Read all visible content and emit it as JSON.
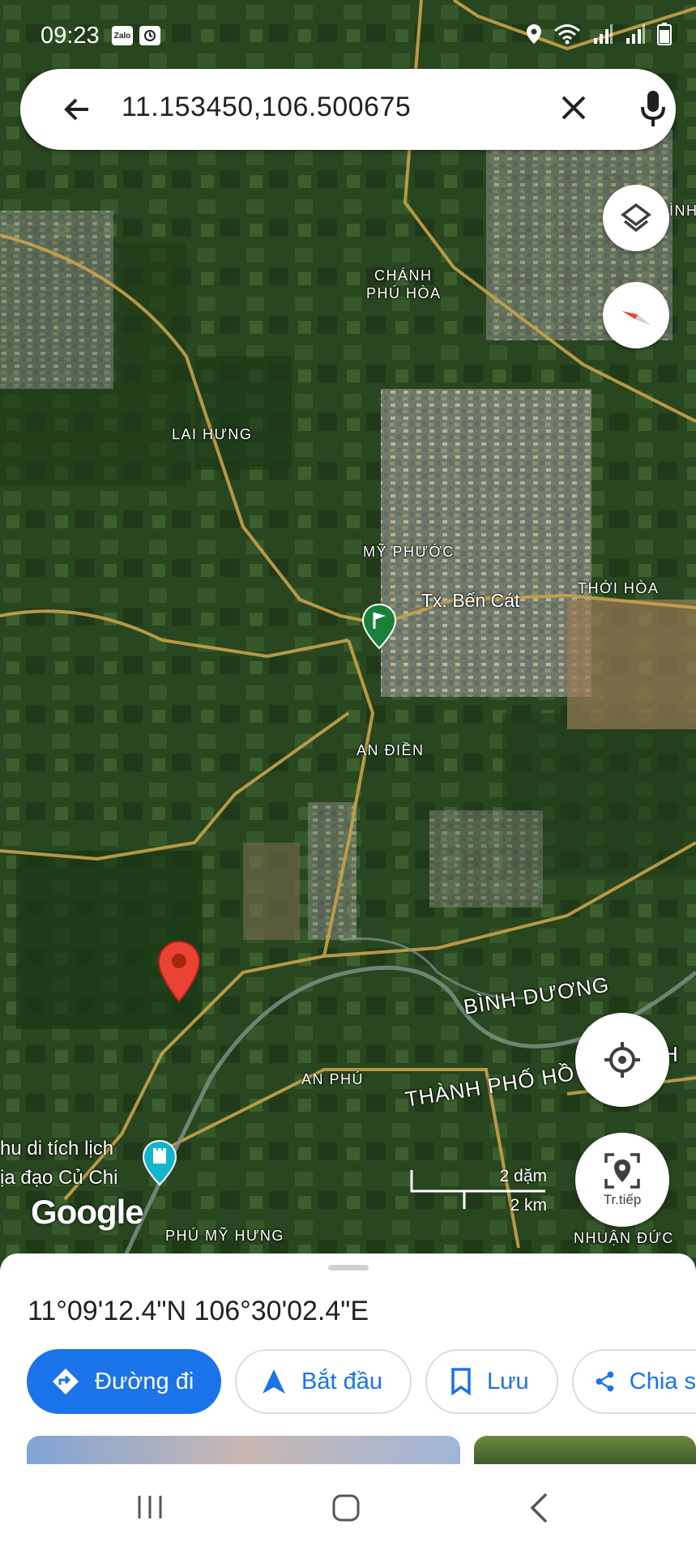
{
  "status_bar": {
    "time": "09:23",
    "left_icons": [
      "zalo-icon",
      "clock-app-icon"
    ],
    "right_icons": [
      "location-icon",
      "wifi-icon",
      "signal-icon",
      "signal-icon",
      "battery-icon"
    ],
    "zalo_label": "Zalo"
  },
  "search": {
    "query": "11.153450,106.500675",
    "back_icon": "arrow-left-icon",
    "clear_icon": "close-icon",
    "mic_icon": "mic-icon"
  },
  "map": {
    "labels": {
      "chanh_phu_hoa_1": "CHÁNH",
      "chanh_phu_hoa_2": "PHÚ HÒA",
      "lai_hung": "LAI HƯNG",
      "my_phuoc": "MỸ PHƯỚC",
      "ben_cat": "Tx. Bến Cát",
      "thoi_hoa": "THỚI HÒA",
      "an_dien": "AN ĐIỀN",
      "binh_duong": "BÌNH DƯƠNG",
      "thanh_pho": "THÀNH PHỐ HỒ",
      "thanh_pho_h": "H",
      "an_phu": "AN PHÚ",
      "cu_chi_1": "hu di tích lịch",
      "cu_chi_2": "ịa đạo Củ Chi",
      "phu_my_hung": "PHÚ MỸ HƯNG",
      "nhuan_duc": "NHUẬN ĐỨC",
      "edge_top_right": "ÌNH"
    },
    "google_logo": "Google",
    "scale": {
      "imperial": "2 dặm",
      "metric": "2 km"
    },
    "pin_color": "#ea4335",
    "flag_pin_color": "#188038"
  },
  "controls": {
    "layers_icon": "layers-icon",
    "compass_icon": "compass-icon",
    "my_location_icon": "my-location-icon",
    "explore_label": "Tr.tiếp"
  },
  "sheet": {
    "coordinates": "11°09'12.4\"N 106°30'02.4\"E",
    "actions": {
      "directions": "Đường đi",
      "start": "Bắt đầu",
      "save": "Lưu",
      "share": "Chia s"
    }
  },
  "colors": {
    "accent": "#1a73e8"
  }
}
